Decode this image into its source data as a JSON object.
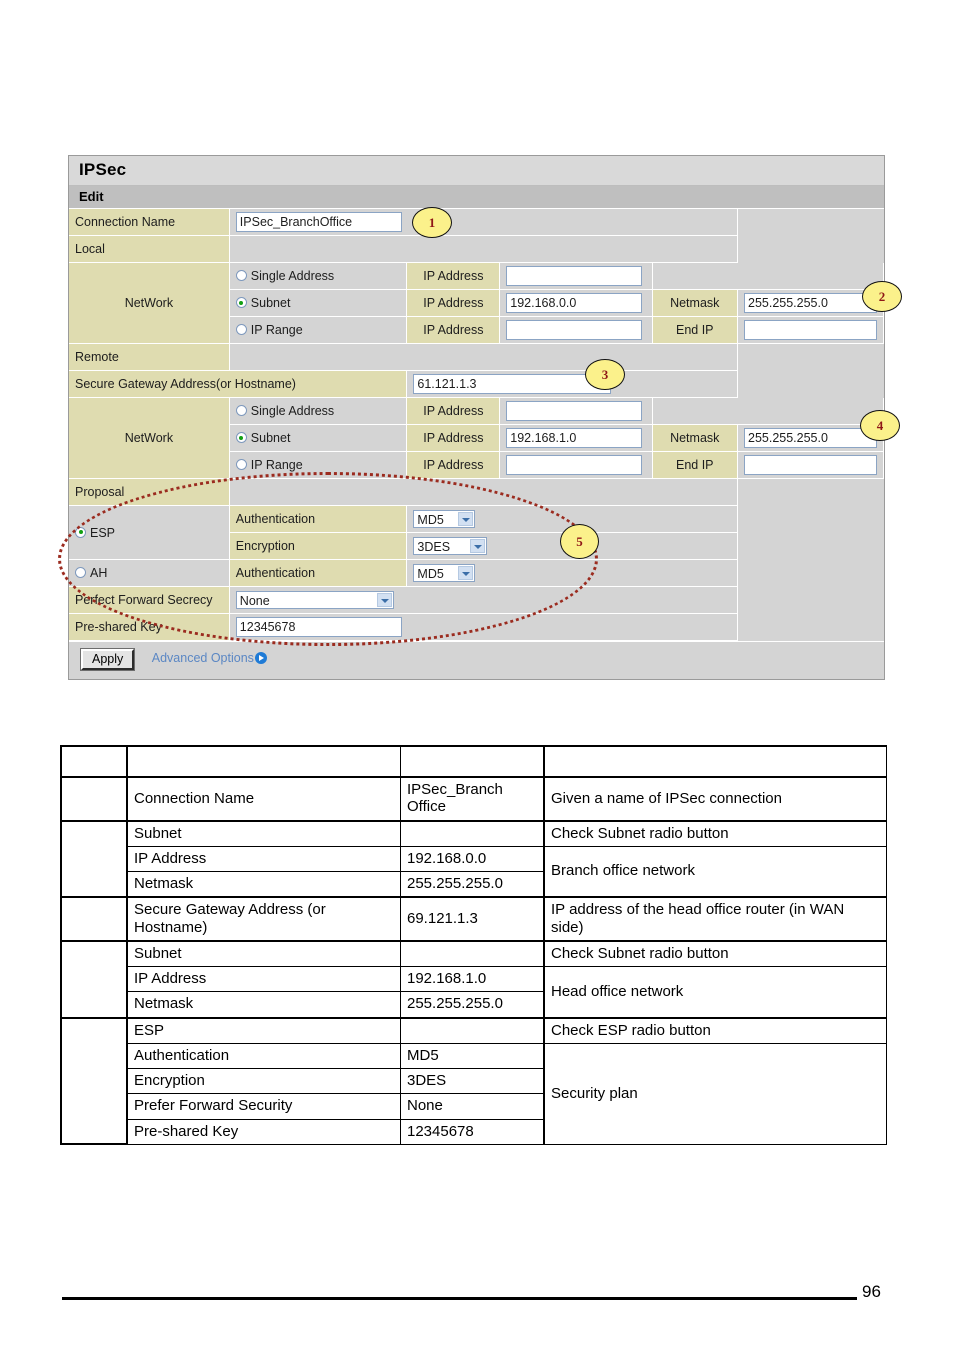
{
  "panel": {
    "title": "IPSec",
    "section": "Edit",
    "rows": {
      "connection_name_label": "Connection Name",
      "connection_name_value": "IPSec_BranchOffice",
      "local_label": "Local",
      "remote_label": "Remote",
      "network_label": "NetWork",
      "proposal_label": "Proposal",
      "secure_gateway_label": "Secure Gateway Address(or Hostname)",
      "secure_gateway_value": "61.121.1.3",
      "pfs_label": "Perfect Forward Secrecy",
      "pfs_value": "None",
      "psk_label": "Pre-shared Key",
      "psk_value": "12345678"
    },
    "radio_labels": {
      "single_address": "Single Address",
      "subnet": "Subnet",
      "ip_range": "IP Range",
      "esp": "ESP",
      "ah": "AH"
    },
    "field_labels": {
      "ip_address": "IP Address",
      "netmask": "Netmask",
      "end_ip": "End IP",
      "authentication": "Authentication",
      "encryption": "Encryption"
    },
    "local_network": {
      "single_ip": "",
      "subnet_ip": "192.168.0.0",
      "subnet_netmask": "255.255.255.0",
      "range_ip": "",
      "range_end_ip": ""
    },
    "remote_network": {
      "single_ip": "",
      "subnet_ip": "192.168.1.0",
      "subnet_netmask": "255.255.255.0",
      "range_ip": "",
      "range_end_ip": ""
    },
    "proposal": {
      "esp_auth": "MD5",
      "esp_encryption": "3DES",
      "ah_auth": "MD5"
    },
    "footer": {
      "apply_label": "Apply",
      "advanced_label": "Advanced Options"
    }
  },
  "callouts": {
    "c1": "1",
    "c2": "2",
    "c3": "3",
    "c4": "4",
    "c5": "5"
  },
  "desc_table": {
    "rows": [
      {
        "num": "",
        "key": "",
        "value": "",
        "desc": "",
        "group": true,
        "empty": true
      },
      {
        "num": "",
        "key": "Connection Name",
        "value": "IPSec_Branch Office",
        "desc": "Given a name of IPSec connection",
        "group": true
      },
      {
        "num": "",
        "key": "Subnet",
        "value": "",
        "desc": "Check Subnet radio button",
        "group": true
      },
      {
        "num": "",
        "key": "IP Address",
        "value": "192.168.0.0",
        "desc": "Branch office network",
        "group": false
      },
      {
        "num": "",
        "key": "Netmask",
        "value": "255.255.255.0",
        "desc": "",
        "group": false
      },
      {
        "num": "",
        "key": "Secure Gateway Address (or Hostname)",
        "value": "69.121.1.3",
        "desc": "IP address of the head office router (in WAN side)",
        "group": true
      },
      {
        "num": "",
        "key": "Subnet",
        "value": "",
        "desc": "Check Subnet radio button",
        "group": true
      },
      {
        "num": "",
        "key": "IP Address",
        "value": "192.168.1.0",
        "desc": "Head office network",
        "group": false
      },
      {
        "num": "",
        "key": "Netmask",
        "value": "255.255.255.0",
        "desc": "",
        "group": false
      },
      {
        "num": "",
        "key": "ESP",
        "value": "",
        "desc": "Check ESP radio button",
        "group": true
      },
      {
        "num": "",
        "key": "Authentication",
        "value": "MD5",
        "desc": "Security plan",
        "group": false
      },
      {
        "num": "",
        "key": "Encryption",
        "value": "3DES",
        "desc": "",
        "group": false
      },
      {
        "num": "",
        "key": "Prefer Forward Security",
        "value": "None",
        "desc": "",
        "group": false
      },
      {
        "num": "",
        "key": "Pre-shared Key",
        "value": "12345678",
        "desc": "",
        "group": false
      }
    ]
  },
  "page": {
    "number": "96"
  },
  "colors": {
    "label_bg": "#dfdcb0",
    "panel_bg": "#d4d4d4",
    "title_bg": "#d9d9d9",
    "section_bg": "#bfbfbf",
    "callout_bg": "#fbf18b",
    "callout_text": "#8f1717",
    "link": "#5b87c4",
    "radio_on": "#12a012",
    "annotation": "#9b2b1f"
  }
}
